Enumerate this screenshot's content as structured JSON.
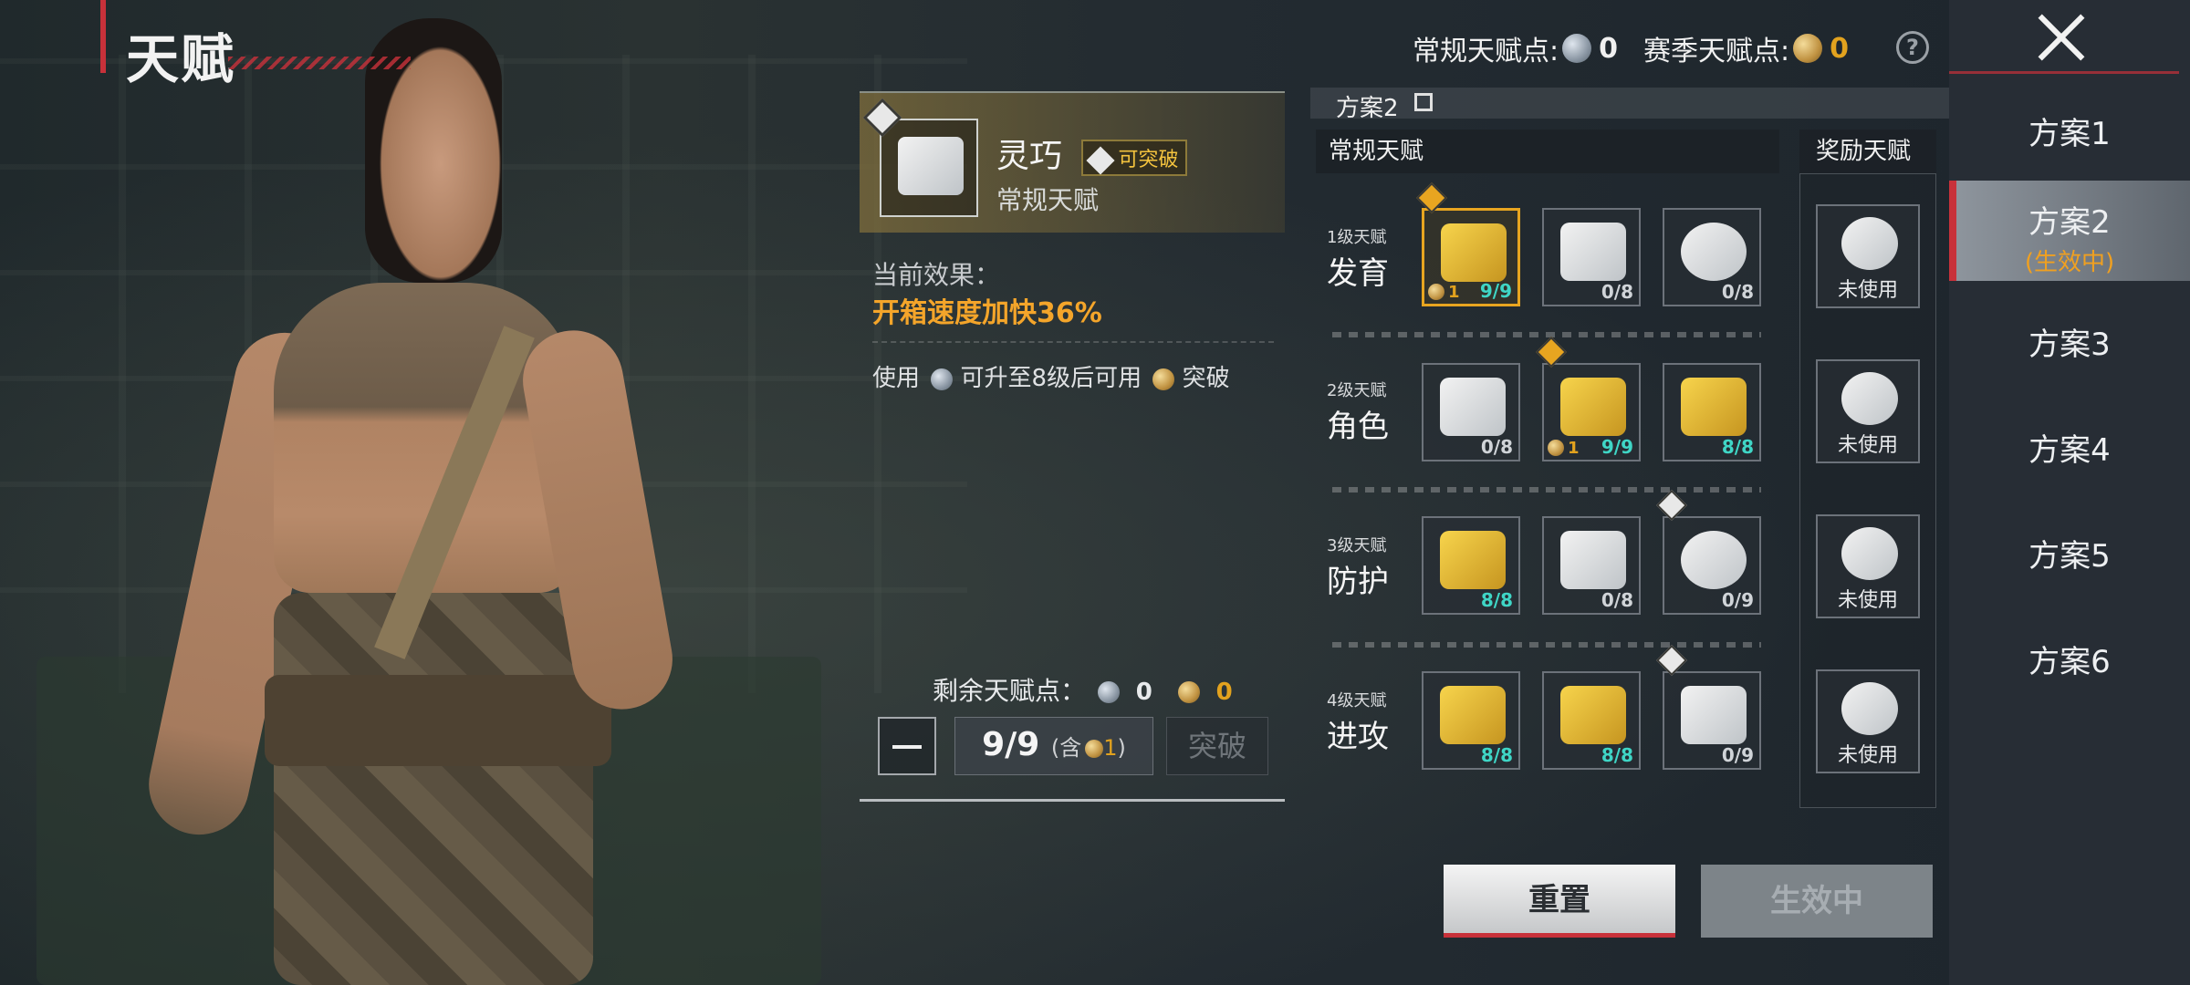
{
  "header": {
    "title": "天赋",
    "regular_points_label": "常规天赋点:",
    "regular_points_value": "0",
    "season_points_label": "赛季天赋点:",
    "season_points_value": "0",
    "help_icon": "?"
  },
  "plans": {
    "current_tab_label": "方案2",
    "items": [
      {
        "label": "方案1",
        "status": ""
      },
      {
        "label": "方案2",
        "status": "(生效中)"
      },
      {
        "label": "方案3",
        "status": ""
      },
      {
        "label": "方案4",
        "status": ""
      },
      {
        "label": "方案5",
        "status": ""
      },
      {
        "label": "方案6",
        "status": ""
      }
    ]
  },
  "detail": {
    "name": "灵巧",
    "breakable_label": "可突破",
    "type": "常规天赋",
    "effect_label": "当前效果：",
    "effect_value": "开箱速度加快36%",
    "use_text_1": "使用",
    "use_text_2": "可升至8级后可用",
    "use_text_3": "突破",
    "remaining_label": "剩余天赋点：",
    "remaining_regular": "0",
    "remaining_season": "0",
    "level": "9/9",
    "level_include_prefix": "(含",
    "level_include_value": "1",
    "level_include_suffix": ")",
    "break_button": "突破"
  },
  "tree": {
    "regular_header": "常规天赋",
    "reward_header": "奖励天赋",
    "rows": [
      {
        "level": "1级天赋",
        "name": "发育",
        "nodes": [
          {
            "icon": "crate-open-icon",
            "count": "9/9",
            "selected": true,
            "breakable": true,
            "break_level": "1"
          },
          {
            "icon": "treasure-box-icon",
            "count": "0/8"
          },
          {
            "icon": "running-soldier-icon",
            "count": "0/8"
          }
        ]
      },
      {
        "level": "2级天赋",
        "name": "角色",
        "nodes": [
          {
            "icon": "soldier-sound-icon",
            "count": "0/8"
          },
          {
            "icon": "sprinting-soldier-icon",
            "count": "9/9",
            "breakable": true,
            "break_level": "1"
          },
          {
            "icon": "backpack-icon",
            "count": "8/8"
          }
        ]
      },
      {
        "level": "3级天赋",
        "name": "防护",
        "nodes": [
          {
            "icon": "muscle-icon",
            "count": "8/8"
          },
          {
            "icon": "vest-armor-icon",
            "count": "0/8"
          },
          {
            "icon": "glove-icon",
            "count": "0/9",
            "breakable": true
          }
        ]
      },
      {
        "level": "4级天赋",
        "name": "进攻",
        "nodes": [
          {
            "icon": "rifle-fire-icon",
            "count": "8/8"
          },
          {
            "icon": "reload-icon",
            "count": "8/8"
          },
          {
            "icon": "shield-break-icon",
            "count": "0/9",
            "breakable": true
          }
        ]
      }
    ],
    "rewards": [
      {
        "icon": "supply-bag-icon",
        "label": "未使用"
      },
      {
        "icon": "strong-soldier-icon",
        "label": "未使用"
      },
      {
        "icon": "airdrop-gun-icon",
        "label": "未使用"
      },
      {
        "icon": "bullet-icon",
        "label": "未使用"
      }
    ]
  },
  "buttons": {
    "reset": "重置",
    "active": "生效中"
  },
  "colors": {
    "accent_red": "#c8313a",
    "gold": "#e2a21e",
    "teal": "#3fd6c6",
    "effect_orange": "#f4a52a"
  }
}
